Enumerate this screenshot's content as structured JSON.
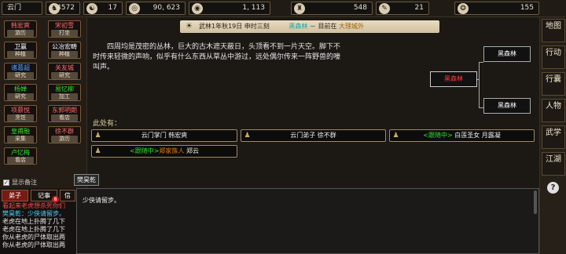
{
  "topbar": {
    "location": "云门",
    "stats": [
      {
        "icon": "horse-icon",
        "glyph": "♞",
        "value": "4572"
      },
      {
        "icon": "yinyang-icon",
        "glyph": "☯",
        "value": "17"
      },
      {
        "icon": "coin-icon",
        "glyph": "◎",
        "value": "90, 623"
      },
      {
        "icon": "gem-icon",
        "glyph": "◉",
        "value": "1, 113"
      },
      {
        "icon": "figure-icon",
        "glyph": "♜",
        "value": "548"
      },
      {
        "icon": "scroll-icon",
        "glyph": "✎",
        "value": "21"
      },
      {
        "icon": "pouch-icon",
        "glyph": "❂",
        "value": "155"
      }
    ]
  },
  "sidebar": {
    "npcs": [
      {
        "name": "韩宏爽",
        "status": "游历",
        "color": "#ff6a6a"
      },
      {
        "name": "宋初雪",
        "status": "打坐",
        "color": "#ff6a6a"
      },
      {
        "name": "卫赢",
        "status": "种植",
        "color": "#ffffff"
      },
      {
        "name": "公冶宏畴",
        "status": "种植",
        "color": "#ffffff"
      },
      {
        "name": "诸葛超",
        "status": "研究",
        "color": "#5aa0ff"
      },
      {
        "name": "关友城",
        "status": "研究",
        "color": "#ff6a6a"
      },
      {
        "name": "杨婵",
        "status": "研究",
        "color": "#2ee02e"
      },
      {
        "name": "易忆柳",
        "status": "加工",
        "color": "#2ee02e"
      },
      {
        "name": "项慕悦",
        "status": "烹饪",
        "color": "#ff6a6a"
      },
      {
        "name": "东郭明朗",
        "status": "看店",
        "color": "#ff6a6a"
      },
      {
        "name": "皇甫融",
        "status": "采集",
        "color": "#2ee02e"
      },
      {
        "name": "徐不群",
        "status": "游历",
        "color": "#ff6a6a"
      },
      {
        "name": "卢忆梅",
        "status": "看店",
        "color": "#2ee02e"
      }
    ],
    "show_remark": "显示备注",
    "checkbox_mark": "✓"
  },
  "header": {
    "icon_glyph": "☀",
    "date": "武林1年秋19日 申时三刻",
    "location": "黑森林",
    "separator": "－ 目前在",
    "city": "大理城外"
  },
  "room": {
    "description": "四周均是茂密的丛林，巨大的古木遮天蔽日，头顶看不到一片天空。脚下不时传来轻微的声响，似乎有什么东西从草丛中游过，远处偶尔传来一阵野兽的嚎叫声。",
    "exits": [
      "黑森林",
      "黑森林",
      "黑森林"
    ],
    "here_label": "此处有：",
    "people": [
      {
        "tag": "",
        "faction": "",
        "text": "云门掌门 韩宏爽"
      },
      {
        "tag": "",
        "faction": "",
        "text": "云门弟子 徐不群"
      },
      {
        "tag": "<跟随中>",
        "faction": "",
        "text": "白莲圣女 月露凝"
      },
      {
        "tag": "<跟随中>",
        "faction": "郑家族人",
        "text": "郑云"
      }
    ]
  },
  "rightmenu": {
    "items": [
      "地图",
      "行动",
      "行囊",
      "人物",
      "武学",
      "江湖"
    ],
    "help": "?"
  },
  "bottom": {
    "tooltip": "樊昊乾",
    "tabs": [
      {
        "label": "弟子",
        "badge": ""
      },
      {
        "label": "记事",
        "badge": "8"
      },
      {
        "label": "信",
        "badge": ""
      }
    ],
    "log": [
      {
        "text": "看起来老虎想杀死你们",
        "color": "#ff4a4a"
      },
      {
        "text": "樊昊乾：少侠请留步。",
        "color": "#4ad0ff"
      },
      {
        "text": "老虎在地上扑腾了几下",
        "color": "#e8e8e8"
      },
      {
        "text": "老虎在地上扑腾了几下",
        "color": "#e8e8e8"
      },
      {
        "text": "你从老虎的尸体取出两",
        "color": "#e8e8e8"
      },
      {
        "text": "你从老虎的尸体取出两",
        "color": "#e8e8e8"
      }
    ],
    "chat_message": "少侠请留步。"
  }
}
